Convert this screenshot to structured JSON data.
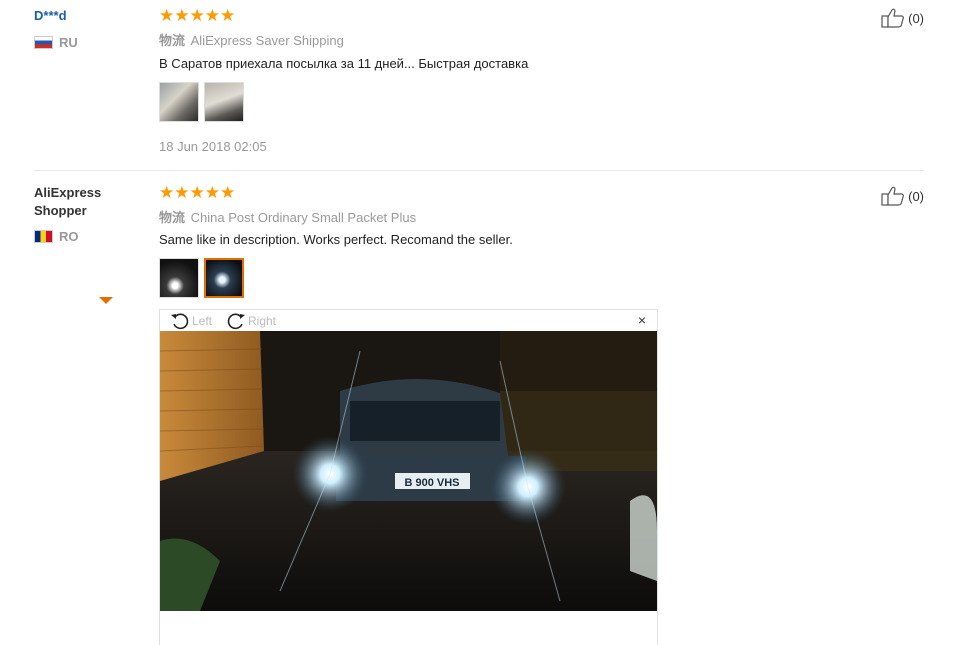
{
  "reviews": [
    {
      "user": "D***d",
      "country": "RU",
      "rating": 5,
      "logistics_tag": "物流",
      "logistics": "AliExpress Saver Shipping",
      "content": "В Саратов приехала посылка за 11 дней... Быстрая доставка",
      "date": "18 Jun 2018 02:05",
      "useful": "(0)"
    },
    {
      "user": "AliExpress Shopper",
      "country": "RO",
      "rating": 5,
      "logistics_tag": "物流",
      "logistics": "China Post Ordinary Small Packet Plus",
      "content": "Same like in description. Works perfect. Recomand the seller.",
      "useful": "(0)"
    }
  ],
  "viewer": {
    "rotate_left": "Left",
    "rotate_right": "Right",
    "close": "×",
    "plate": "B 900 VHS"
  },
  "icons": {
    "star": "★",
    "thumb": "thumbs-up-icon"
  },
  "colors": {
    "star": "#ff9a00",
    "link_user": "#1a5dab",
    "muted": "#999999",
    "selected_thumb_border": "#e86d00"
  }
}
